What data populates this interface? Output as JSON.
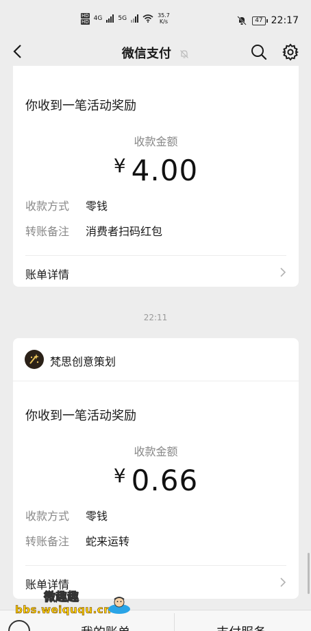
{
  "status_bar": {
    "hd1": "HD",
    "hd2": "HD",
    "net1": "4G",
    "net2": "5G",
    "speed_value": "35.7",
    "speed_unit": "K/s",
    "battery": "47",
    "time": "22:17"
  },
  "nav": {
    "title": "微信支付",
    "icons": [
      "back-icon",
      "mute-bell-icon",
      "search-icon",
      "gear-icon"
    ]
  },
  "cards": [
    {
      "title": "你收到一笔活动奖励",
      "amount_label": "收款金额",
      "currency": "¥",
      "amount": "4.00",
      "rows": [
        {
          "key": "收款方式",
          "value": "零钱"
        },
        {
          "key": "转账备注",
          "value": "消费者扫码红包"
        }
      ],
      "detail_label": "账单详情"
    },
    {
      "merchant_name": "梵思创意策划",
      "title": "你收到一笔活动奖励",
      "amount_label": "收款金额",
      "currency": "¥",
      "amount": "0.66",
      "rows": [
        {
          "key": "收款方式",
          "value": "零钱"
        },
        {
          "key": "转账备注",
          "value": "蛇来运转"
        }
      ],
      "detail_label": "账单详情"
    }
  ],
  "timestamp": "22:11",
  "bottom_tabs": [
    "我的账单",
    "支付服务"
  ],
  "watermark": {
    "top": "微趣趣",
    "url": "bbs.weiququ.cn"
  },
  "colors": {
    "background": "#ededed",
    "card": "#ffffff",
    "muted_text": "#888888",
    "watermark_yellow": "#ffd400"
  }
}
